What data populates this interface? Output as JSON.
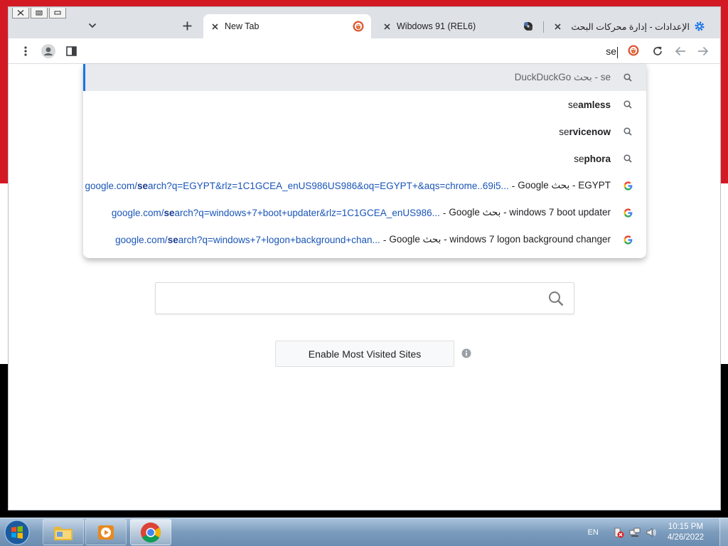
{
  "browser": {
    "tabs": [
      {
        "title": "New Tab",
        "active": true,
        "favicon": "duckduckgo-icon"
      },
      {
        "title": "Wibdows 91 (REL6)",
        "active": false,
        "favicon": "extension-puzzle-icon"
      },
      {
        "title": "الإعدادات - إدارة محركات البحث والبحث في",
        "active": false,
        "favicon": "settings-gear-icon"
      }
    ],
    "omnibox": {
      "value": "se",
      "search_engine_icon": "duckduckgo-icon"
    },
    "suggestions": [
      {
        "type": "search",
        "typed": "",
        "rest": "se - بحث DuckDuckGo",
        "grey": true,
        "icon": "search-icon"
      },
      {
        "type": "search",
        "typed": "se",
        "rest": "amless",
        "icon": "search-icon"
      },
      {
        "type": "search",
        "typed": "se",
        "rest": "rvicenow",
        "icon": "search-icon"
      },
      {
        "type": "search",
        "typed": "se",
        "rest": "phora",
        "icon": "search-icon"
      },
      {
        "type": "history",
        "url_prefix": "google.com/",
        "url_typed": "se",
        "url_rest": "arch?q=EGYPT&rlz=1C1GCEA_enUS986US986&oq=EGYPT+&aqs=chrome..69i5...",
        "title": "EGYPT - بحث Google",
        "icon": "google-icon"
      },
      {
        "type": "history",
        "url_prefix": "google.com/",
        "url_typed": "se",
        "url_rest": "arch?q=windows+7+boot+updater&rlz=1C1GCEA_enUS986...",
        "title": "windows 7 boot updater - بحث Google",
        "icon": "google-icon"
      },
      {
        "type": "history",
        "url_prefix": "google.com/",
        "url_typed": "se",
        "url_rest": "arch?q=windows+7+logon+background+chan...",
        "title": "windows 7 logon background changer - بحث Google",
        "icon": "google-icon"
      }
    ]
  },
  "ntp": {
    "mv_button_label": "Enable Most Visited Sites"
  },
  "taskbar": {
    "language": "EN",
    "time": "10:15 PM",
    "date": "4/26/2022"
  },
  "colors": {
    "accent": "#1a73e8",
    "wallpaper_red": "#d31a24",
    "taskbar": "#7c9cbd"
  }
}
